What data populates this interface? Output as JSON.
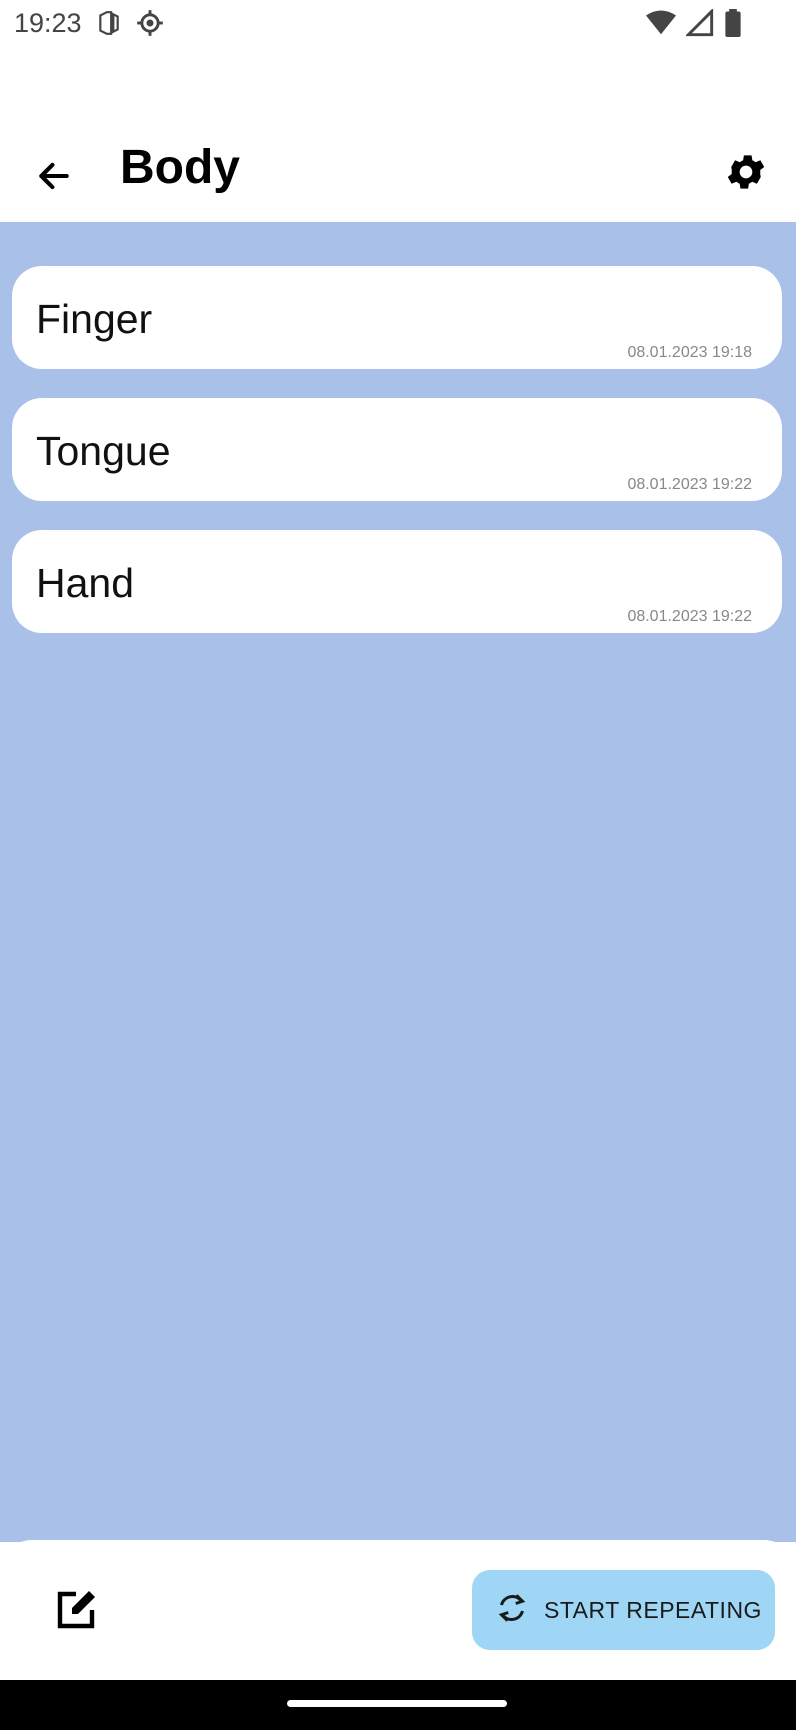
{
  "status_bar": {
    "time": "19:23",
    "icons": [
      "sim-card-icon",
      "settings-gear-icon",
      "wifi-icon",
      "signal-icon",
      "battery-icon"
    ]
  },
  "app_bar": {
    "title": "Body",
    "back_icon": "arrow-back-icon",
    "settings_icon": "gear-icon"
  },
  "colors": {
    "content_bg": "#a9c0e9",
    "card_bg": "#ffffff",
    "repeat_button_bg": "#9fd6f6"
  },
  "items": [
    {
      "name": "Finger",
      "date": "08.01.2023 19:18"
    },
    {
      "name": "Tongue",
      "date": "08.01.2023 19:22"
    },
    {
      "name": "Hand",
      "date": "08.01.2023 19:22"
    }
  ],
  "bottom_bar": {
    "edit_icon": "edit-icon",
    "repeat_icon": "sync-icon",
    "repeat_label": "START REPEATING"
  }
}
